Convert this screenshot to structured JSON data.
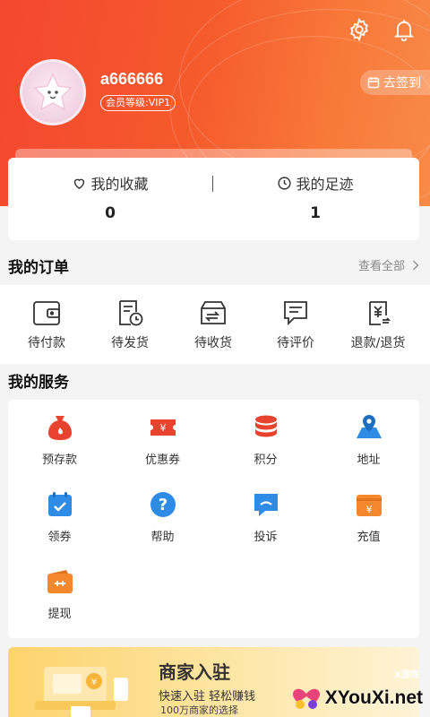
{
  "header": {
    "settings_icon": "gear-icon",
    "notifications_icon": "bell-icon",
    "username": "a666666",
    "member_level": "会员等级:VIP1",
    "checkin_label": "去签到"
  },
  "stats": {
    "favorites_label": "我的收藏",
    "favorites_count": "0",
    "history_label": "我的足迹",
    "history_count": "1"
  },
  "orders": {
    "title": "我的订单",
    "view_all": "查看全部",
    "items": [
      {
        "label": "待付款",
        "icon": "wallet-icon"
      },
      {
        "label": "待发货",
        "icon": "pending-ship-icon"
      },
      {
        "label": "待收货",
        "icon": "box-icon"
      },
      {
        "label": "待评价",
        "icon": "review-icon"
      },
      {
        "label": "退款/退货",
        "icon": "refund-icon"
      }
    ]
  },
  "services": {
    "title": "我的服务",
    "items": [
      {
        "label": "预存款",
        "icon": "money-bag-icon"
      },
      {
        "label": "优惠券",
        "icon": "coupon-icon"
      },
      {
        "label": "积分",
        "icon": "points-icon"
      },
      {
        "label": "地址",
        "icon": "location-icon"
      },
      {
        "label": "领券",
        "icon": "calendar-check-icon"
      },
      {
        "label": "帮助",
        "icon": "help-icon"
      },
      {
        "label": "投诉",
        "icon": "complaint-icon"
      },
      {
        "label": "充值",
        "icon": "recharge-icon"
      },
      {
        "label": "提现",
        "icon": "withdraw-icon"
      }
    ]
  },
  "banner": {
    "title": "商家入驻",
    "subtitle": "快速入驻 轻松赚钱",
    "subtitle2": "100万商家的选择"
  },
  "watermark": {
    "top": "X游戏",
    "text": "XYouXi.net"
  },
  "colors": {
    "brand": "#f4472f",
    "service_red": "#e8432e",
    "service_blue": "#2e8be6",
    "service_orange": "#f3892c"
  }
}
